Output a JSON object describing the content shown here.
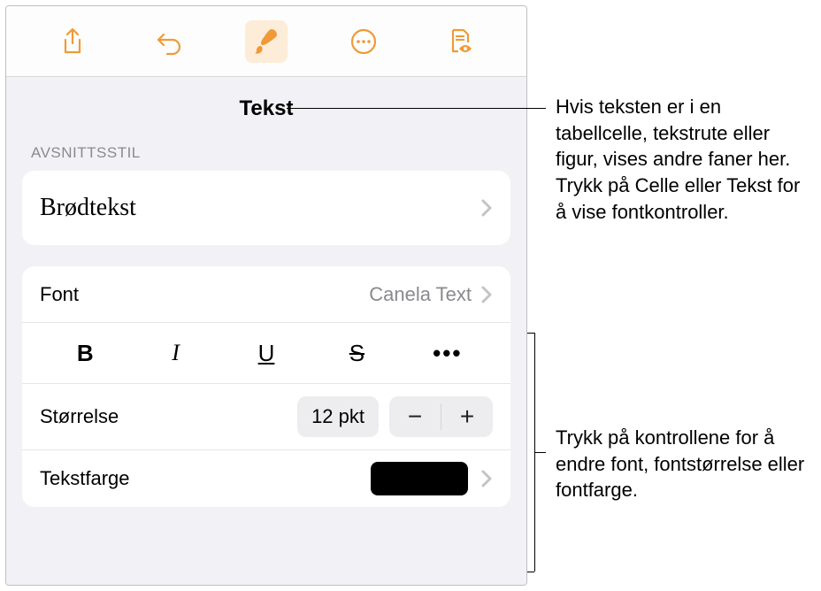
{
  "toolbar": {
    "share": "share-icon",
    "undo": "undo-icon",
    "format": "format-icon",
    "more": "more-icon",
    "reader": "reader-icon"
  },
  "tab_title": "Tekst",
  "section_label": "AVSNITTSSTIL",
  "paragraph_style": "Brødtekst",
  "font": {
    "label": "Font",
    "value": "Canela Text"
  },
  "format_buttons": {
    "bold": "B",
    "italic": "I",
    "underline": "U",
    "strike": "S",
    "more": "•••"
  },
  "size": {
    "label": "Størrelse",
    "value": "12 pkt",
    "minus": "−",
    "plus": "+"
  },
  "textcolor": {
    "label": "Tekstfarge",
    "value": "#000000"
  },
  "callouts": {
    "top": "Hvis teksten er i en tabellcelle, tekstrute eller figur, vises andre faner her. Trykk på Celle eller Tekst for å vise fontkontroller.",
    "bottom": "Trykk på kontrollene for å endre font, fontstørrelse eller fontfarge."
  }
}
